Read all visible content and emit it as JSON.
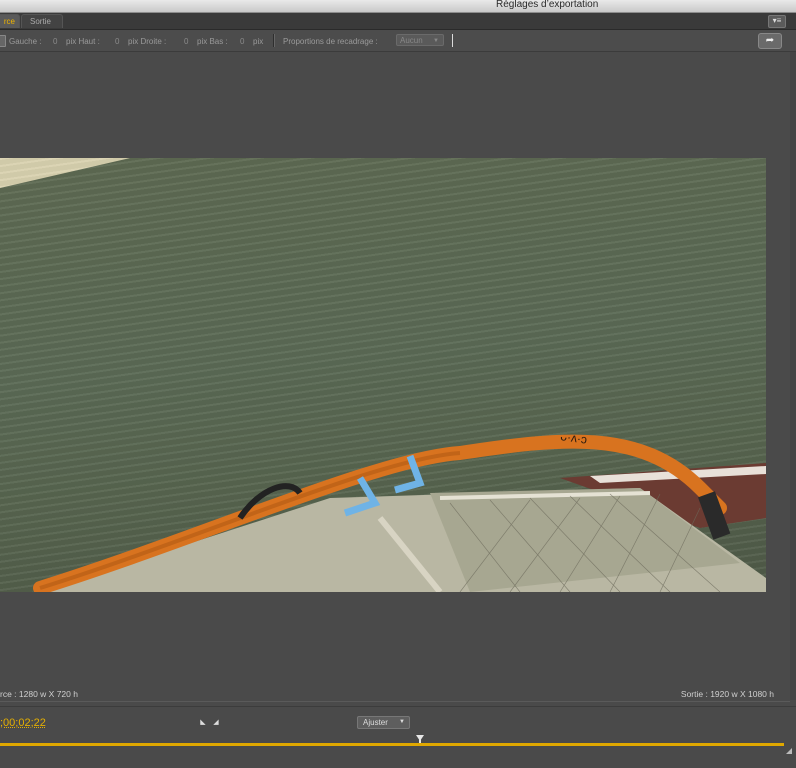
{
  "window": {
    "title": "Réglages d’exportation"
  },
  "tabs": [
    {
      "label": "rce",
      "active": true
    },
    {
      "label": "Sortie",
      "active": false
    }
  ],
  "toolbar": {
    "left_label": "Gauche :",
    "left_value": "0",
    "top_label": "pix Haut :",
    "top_value": "0",
    "right_label": "pix Droite :",
    "right_value": "0",
    "bottom_label": "pix Bas :",
    "bottom_value": "0",
    "unit": "pix",
    "ratio_label": "Proportions de recadrage :",
    "ratio_value": "Aucun",
    "dropdown_arrow": "▼",
    "export_icon": "➦"
  },
  "panel_menu_icon": "▾≡",
  "info": {
    "source": "rce : 1280 w X 720 h",
    "output": "Sortie : 1920 w X 1080 h"
  },
  "timeline": {
    "timecode": ";00;02;22",
    "mark_in": "◣",
    "mark_out": "◢",
    "zoom_label": "Ajuster",
    "zoom_arrow": "▼",
    "playhead_fraction": 0.536
  },
  "colors": {
    "accent": "#e6b000",
    "panel": "#4a4a4a"
  }
}
